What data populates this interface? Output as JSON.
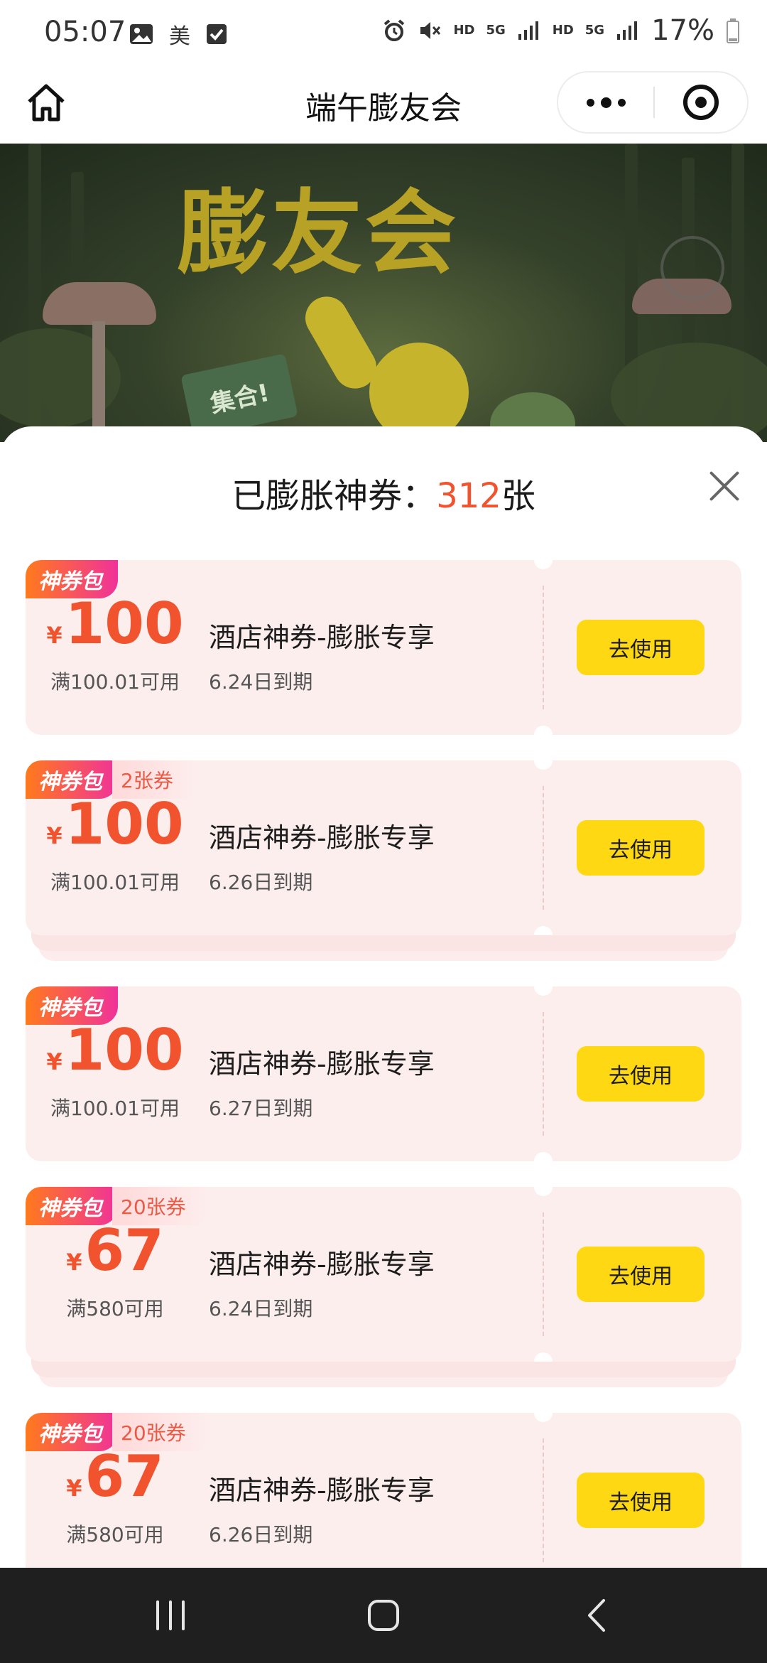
{
  "status_bar": {
    "time": "05:07",
    "app_char": "美",
    "net_label_1": "HD",
    "net_label_2": "5G",
    "net_label_3": "HD",
    "net_label_4": "5G",
    "battery": "17%"
  },
  "header": {
    "title": "端午膨友会"
  },
  "banner": {
    "title_text": "膨友会",
    "flag_text": "集合!"
  },
  "sheet": {
    "title_prefix": "已膨胀神券：",
    "count": "312",
    "title_suffix": "张"
  },
  "coupons": [
    {
      "tag": "神券包",
      "extra": "",
      "yen": "¥",
      "amount": "100",
      "condition": "满100.01可用",
      "name": "酒店神券-膨胀专享",
      "expiry": "6.24日到期",
      "button": "去使用"
    },
    {
      "tag": "神券包",
      "extra": "2张券",
      "yen": "¥",
      "amount": "100",
      "condition": "满100.01可用",
      "name": "酒店神券-膨胀专享",
      "expiry": "6.26日到期",
      "button": "去使用"
    },
    {
      "tag": "神券包",
      "extra": "",
      "yen": "¥",
      "amount": "100",
      "condition": "满100.01可用",
      "name": "酒店神券-膨胀专享",
      "expiry": "6.27日到期",
      "button": "去使用"
    },
    {
      "tag": "神券包",
      "extra": "20张券",
      "yen": "¥",
      "amount": "67",
      "condition": "满580可用",
      "name": "酒店神券-膨胀专享",
      "expiry": "6.24日到期",
      "button": "去使用"
    },
    {
      "tag": "神券包",
      "extra": "20张券",
      "yen": "¥",
      "amount": "67",
      "condition": "满580可用",
      "name": "酒店神券-膨胀专享",
      "expiry": "6.26日到期",
      "button": "去使用"
    }
  ],
  "colors": {
    "accent": "#f0532e",
    "button": "#ffd814",
    "coupon_bg": "#fdeeee"
  }
}
